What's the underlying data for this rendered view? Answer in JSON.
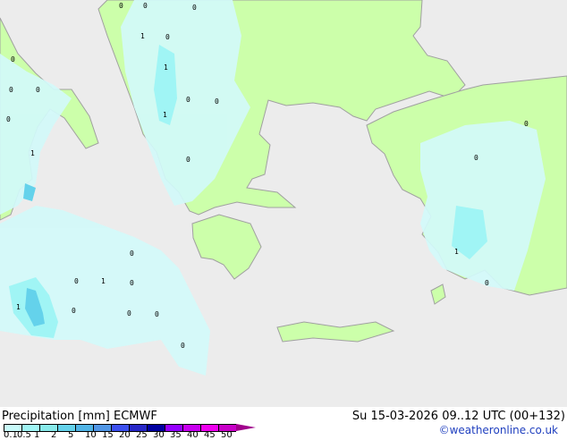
{
  "map": {
    "colors": {
      "sea": "#ececec",
      "land": "#ccffaa",
      "border": "#a0a0a0",
      "precip_light": "#d2fafa",
      "precip_mid": "#a0f5f5",
      "precip_high": "#64d2eb"
    },
    "labels": [
      "0",
      "0",
      "0",
      "1",
      "0",
      "1",
      "0",
      "0",
      "0",
      "0",
      "1",
      "0",
      "0",
      "1",
      "0",
      "0",
      "1",
      "1",
      "0",
      "0",
      "0",
      "0",
      "0",
      "0",
      "1",
      "0",
      "0",
      "0"
    ]
  },
  "footer": {
    "title": "Precipitation [mm]  ECMWF",
    "datetime": "Su 15-03-2026 09..12 UTC (00+132)",
    "credit": "©weatheronline.co.uk",
    "legend": {
      "colors": [
        "#c8fafa",
        "#a0f5f5",
        "#88eaea",
        "#64d2eb",
        "#50b4e6",
        "#5096e6",
        "#3c50f0",
        "#2828c8",
        "#0000a0",
        "#9600ff",
        "#c800f0",
        "#f000f0",
        "#c800c8"
      ],
      "ticks": [
        "0.1",
        "0.5",
        "1",
        "2",
        "5",
        "10",
        "15",
        "20",
        "25",
        "30",
        "35",
        "40",
        "45",
        "50"
      ]
    }
  }
}
